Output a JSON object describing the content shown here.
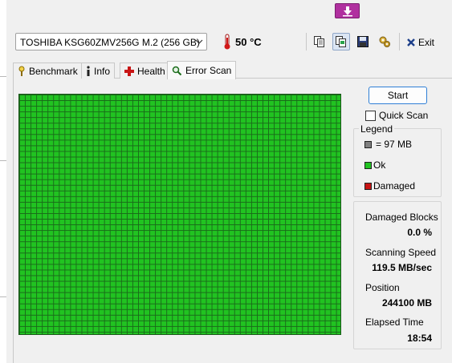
{
  "toolbar": {
    "drive": "TOSHIBA KSG60ZMV256G M.2 (256 GB)",
    "temperature": "50 °C",
    "exit_label": "Exit",
    "icons": [
      "download-icon",
      "thermometer-icon",
      "copy-text-icon",
      "copy-screenshot-icon",
      "save-icon",
      "options-icon",
      "exit-icon"
    ]
  },
  "tabs": [
    {
      "label": "Benchmark",
      "icon": "benchmark-icon"
    },
    {
      "label": "Info",
      "icon": "info-icon"
    },
    {
      "label": "Health",
      "icon": "health-icon"
    },
    {
      "label": "Error Scan",
      "icon": "error-scan-icon",
      "active": true
    }
  ],
  "scan": {
    "start_label": "Start",
    "quick_scan_label": "Quick Scan",
    "quick_scan_checked": false,
    "legend": {
      "title": "Legend",
      "items": [
        {
          "label": "= 97 MB",
          "color": "#808080"
        },
        {
          "label": "Ok",
          "color": "#21c321"
        },
        {
          "label": "Damaged",
          "color": "#c81414"
        }
      ]
    },
    "stats": {
      "damaged_blocks_label": "Damaged Blocks",
      "damaged_blocks_value": "0.0 %",
      "scanning_speed_label": "Scanning Speed",
      "scanning_speed_value": "119.5 MB/sec",
      "position_label": "Position",
      "position_value": "244100 MB",
      "elapsed_time_label": "Elapsed Time",
      "elapsed_time_value": "18:54"
    },
    "block_status": "Ok"
  },
  "colors": {
    "ok": "#21c321",
    "damaged": "#c81414",
    "accent": "#2f7fd6"
  }
}
